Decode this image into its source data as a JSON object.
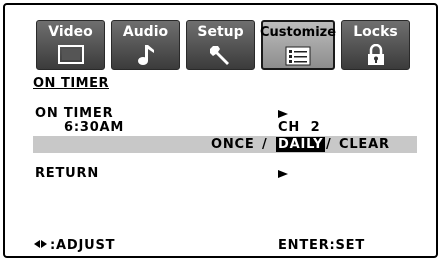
{
  "menu_tabs": [
    {
      "label": "Video",
      "icon": "screen-icon"
    },
    {
      "label": "Audio",
      "icon": "music-note-icon"
    },
    {
      "label": "Setup",
      "icon": "wrench-icon"
    },
    {
      "label": "Customize",
      "icon": "list-icon"
    },
    {
      "label": "Locks",
      "icon": "padlock-icon"
    }
  ],
  "active_tab": "Customize",
  "heading": "ON TIMER",
  "on_timer": {
    "label": "ON TIMER",
    "time": "6:30AM",
    "channel": "CH  2",
    "options": [
      "ONCE",
      "DAILY",
      "CLEAR"
    ],
    "separator": "/",
    "selected_option": "DAILY"
  },
  "return_label": "RETURN",
  "footer": {
    "adjust_label": ":ADJUST",
    "set_label": "ENTER:SET"
  },
  "colors": {
    "tab_dark": "#4a4a4a",
    "tab_active": "#a8a8a8",
    "highlight_band": "#c8c8c8",
    "selected_bg": "#000000"
  }
}
